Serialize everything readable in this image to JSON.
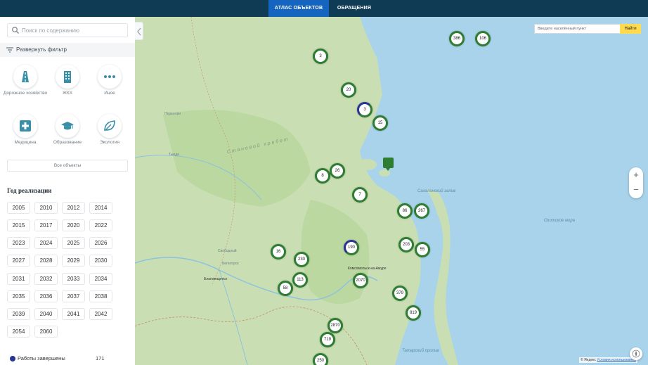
{
  "nav": {
    "tabs": [
      {
        "label": "АТЛАС ОБЪЕКТОВ",
        "active": true
      },
      {
        "label": "ОБРАЩЕНИЯ",
        "active": false
      }
    ]
  },
  "sidebar": {
    "search_placeholder": "Поиск по содержанию",
    "filter_label": "Развернуть фильтр",
    "categories": [
      {
        "label": "Дорожное хозяйство",
        "icon": "road-icon"
      },
      {
        "label": "ЖКХ",
        "icon": "building-icon"
      },
      {
        "label": "Иное",
        "icon": "dots-icon"
      },
      {
        "label": "Медицина",
        "icon": "medical-cross-icon"
      },
      {
        "label": "Образование",
        "icon": "graduation-cap-icon"
      },
      {
        "label": "Экология",
        "icon": "leaf-icon"
      }
    ],
    "all_objects_label": "Все объекты",
    "year_title": "Год реализации",
    "years": [
      "2005",
      "2010",
      "2012",
      "2014",
      "2015",
      "2017",
      "2020",
      "2022",
      "2023",
      "2024",
      "2025",
      "2026",
      "2027",
      "2028",
      "2029",
      "2030",
      "2031",
      "2032",
      "2033",
      "2034",
      "2035",
      "2036",
      "2037",
      "2038",
      "2039",
      "2040",
      "2041",
      "2042",
      "2054",
      "2060"
    ],
    "legend": {
      "label": "Работы завершены",
      "count": "171",
      "color": "#283593"
    }
  },
  "map": {
    "city_search_placeholder": "Введите населённый пункт",
    "city_search_button": "Найти",
    "zoom_in": "+",
    "zoom_out": "−",
    "copyright_prefix": "© Яндекс",
    "copyright_link": "Условия использования",
    "clusters": [
      "386",
      "106",
      "3",
      "20",
      "3",
      "15",
      "8",
      "26",
      "7",
      "86",
      "267",
      "16",
      "230",
      "190",
      "203",
      "55",
      "113",
      "58",
      "2070",
      "379",
      "819",
      "2870",
      "719",
      "250"
    ],
    "labels": {
      "sea": "Охотское море",
      "bay": "Сахалинский залив",
      "ridge": "Становой хребет",
      "city1": "Комсомольск-на-Амуре",
      "city2": "Благовещенск",
      "city3": "Белогорск",
      "city4": "Свободный",
      "city5": "Нерюнгри",
      "city6": "Тында",
      "gulf": "Татарский пролив"
    },
    "colors": {
      "cluster_green": "#2e7d32",
      "cluster_blue": "#283593",
      "water": "#a8d3ea",
      "land": "#c9dfb3"
    }
  }
}
